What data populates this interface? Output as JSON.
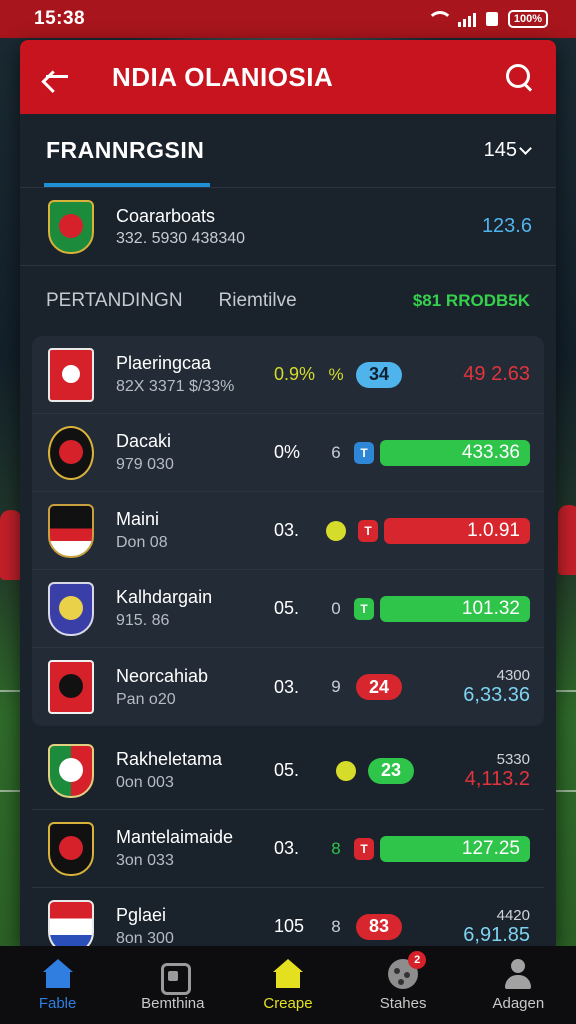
{
  "status_bar": {
    "time": "15:38",
    "battery": "100%"
  },
  "app_bar": {
    "title": "NDIA OLANIOSIA",
    "back_icon": "arrow-left-icon",
    "search_icon": "search-icon"
  },
  "section": {
    "title": "FRANNRGSIN",
    "count": "145"
  },
  "featured": {
    "name": "Coararboats",
    "sub": "332. 5930 438340",
    "value": "123.6"
  },
  "tabs": {
    "left": "PERTANDINGN",
    "middle": "Riemtilve",
    "right": "$81 RRODB5K"
  },
  "colors": {
    "accent_red": "#c8141e",
    "accent_blue": "#1f8fd6",
    "green": "#2ec54a",
    "red": "#d8262e",
    "yellow": "#d6dc2a"
  },
  "rows": [
    {
      "name": "Plaeringcaa",
      "meta": "82X 3371 $/33%",
      "odds": "0.9%",
      "mid": "%",
      "pill": "34",
      "value": "49 2.63"
    },
    {
      "name": "Dacaki",
      "meta": "979 030",
      "odds": "0%",
      "mid": "6",
      "ind": "T",
      "bar": "433.36"
    },
    {
      "name": "Maini",
      "meta": "Don 08",
      "odds": "03.",
      "mid": "",
      "ind": "T",
      "bar": "1.0.91"
    },
    {
      "name": "Kalhdargain",
      "meta": "915. 86",
      "odds": "05.",
      "mid": "0",
      "ind": "T",
      "bar": "101.32"
    },
    {
      "name": "Neorcahiab",
      "meta": "Pan o20",
      "odds": "03.",
      "mid": "9",
      "pill": "24",
      "top": "4300",
      "value": "6,33.36"
    },
    {
      "name": "Rakheletama",
      "meta": "0on 003",
      "odds": "05.",
      "mid": "",
      "pill": "23",
      "top": "5330",
      "value": "4,113.2"
    },
    {
      "name": "Mantelaimaide",
      "meta": "3on 033",
      "odds": "03.",
      "mid": "8",
      "ind": "T",
      "bar": "127.25"
    },
    {
      "name": "Pglaei",
      "meta": "8on 300",
      "odds": "105",
      "mid": "8",
      "pill": "83",
      "top": "4420",
      "value": "6,91.85"
    }
  ],
  "nav": [
    {
      "label": "Fable",
      "icon": "home-icon"
    },
    {
      "label": "Bemthina",
      "icon": "bag-icon"
    },
    {
      "label": "Creape",
      "icon": "home-icon"
    },
    {
      "label": "Stahes",
      "icon": "ball-icon",
      "badge": "2"
    },
    {
      "label": "Adagen",
      "icon": "person-icon"
    }
  ]
}
